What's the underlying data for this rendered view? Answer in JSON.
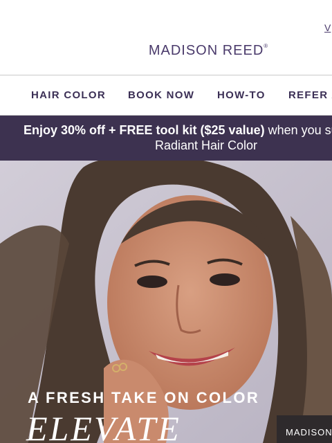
{
  "header": {
    "top_link": "V",
    "brand": "MADISON REED",
    "brand_mark": "®"
  },
  "nav": {
    "items": [
      "HAIR COLOR",
      "BOOK NOW",
      "HOW-TO",
      "REFER A"
    ]
  },
  "promo": {
    "bold_text": "Enjoy 30% off + FREE tool kit ($25 value)",
    "regular_text": " when you su",
    "line2": "Radiant Hair Color"
  },
  "hero": {
    "kicker": "A FRESH TAKE ON COLOR",
    "title": "ELEVATE",
    "badge": "MADISON R"
  },
  "colors": {
    "brand_purple": "#4a3a6b",
    "promo_bg": "#3d3250"
  }
}
